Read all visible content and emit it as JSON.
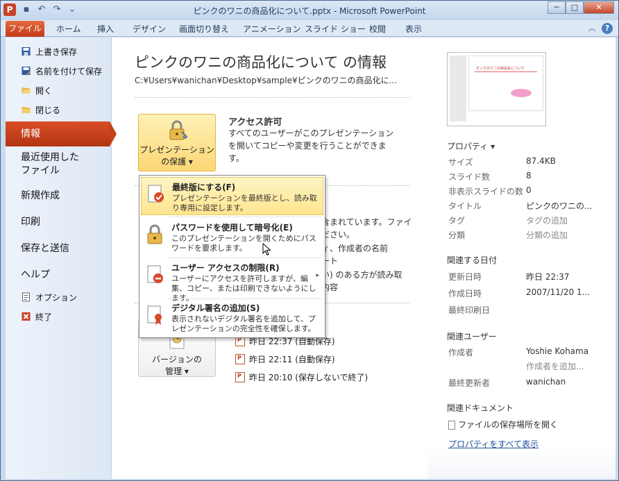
{
  "window": {
    "title": "ピンクのワニの商品化について.pptx - Microsoft PowerPoint",
    "app_icon": "P",
    "controls": {
      "minimize": "─",
      "maximize": "□",
      "close": "✕"
    }
  },
  "ribbon": {
    "file_tab": "ファイル",
    "tabs": [
      "ホーム",
      "挿入",
      "デザイン",
      "画面切り替え",
      "アニメーション",
      "スライド ショー",
      "校閲",
      "表示"
    ],
    "help": "?",
    "collapse": "︿"
  },
  "nav": {
    "save": "上書き保存",
    "save_as": "名前を付けて保存",
    "open": "開く",
    "close": "閉じる",
    "info": "情報",
    "recent": "最近使用した\nファイル",
    "new": "新規作成",
    "print": "印刷",
    "save_send": "保存と送信",
    "help": "ヘルプ",
    "options": "オプション",
    "exit": "終了"
  },
  "info": {
    "title": "ピンクのワニの商品化について の情報",
    "path": "C:¥Users¥wanichan¥Desktop¥sample¥ピンクのワニの商品化に...",
    "protect_button": "プレゼンテーション\nの保護 ▾",
    "permissions_title": "アクセス許可",
    "permissions_desc": "すべてのユーザーがこのプレゼンテーションを開いてコピーや変更を行うことができます。",
    "bg_fragments": [
      "含まれています。ファイ",
      "ださい。",
      "ィ、作成者の名前",
      "ート",
      "い) のある方が読み取",
      "内容"
    ],
    "versions_button": "バージョンの\n管理 ▾",
    "versions": [
      "昨日 22:37 (自動保存)",
      "昨日 22:11 (自動保存)",
      "昨日 20:10 (保存しないで終了)"
    ]
  },
  "dropdown": [
    {
      "title": "最終版にする(F)",
      "desc": "プレゼンテーションを最終版とし、読み取り専用に設定します。",
      "highlighted": true
    },
    {
      "title": "パスワードを使用して暗号化(E)",
      "desc": "このプレゼンテーションを開くためにパスワードを要求します。",
      "highlighted": false
    },
    {
      "title": "ユーザー アクセスの制限(R)",
      "desc": "ユーザーにアクセスを許可しますが、編集、コピー、または印刷できないようにします。",
      "highlighted": false,
      "submenu": "▸"
    },
    {
      "title": "デジタル署名の追加(S)",
      "desc": "表示されないデジタル署名を追加して、プレゼンテーションの完全性を確保します。",
      "highlighted": false
    }
  ],
  "properties": {
    "thumb_title": "ピンクのワニの商品化について",
    "header": "プロパティ ▾",
    "rows": [
      {
        "label": "サイズ",
        "value": "87.4KB",
        "hint": false
      },
      {
        "label": "スライド数",
        "value": "8",
        "hint": false
      },
      {
        "label": "非表示スライドの数",
        "value": "0",
        "hint": false
      },
      {
        "label": "タイトル",
        "value": "ピンクのワニの...",
        "hint": false
      },
      {
        "label": "タグ",
        "value": "タグの追加",
        "hint": true
      },
      {
        "label": "分類",
        "value": "分類の追加",
        "hint": true
      }
    ],
    "dates_header": "関連する日付",
    "dates": [
      {
        "label": "更新日時",
        "value": "昨日 22:37"
      },
      {
        "label": "作成日時",
        "value": "2007/11/20 1..."
      },
      {
        "label": "最終印刷日",
        "value": ""
      }
    ],
    "people_header": "関連ユーザー",
    "author_label": "作成者",
    "author_value": "Yoshie Kohama",
    "add_author": "作成者を追加...",
    "last_modified_label": "最終更新者",
    "last_modified_value": "wanichan",
    "docs_header": "関連ドキュメント",
    "open_location": "ファイルの保存場所を開く",
    "show_all": "プロパティをすべて表示"
  },
  "colors": {
    "accent": "#c43f1a",
    "highlight": "#fde58f"
  }
}
